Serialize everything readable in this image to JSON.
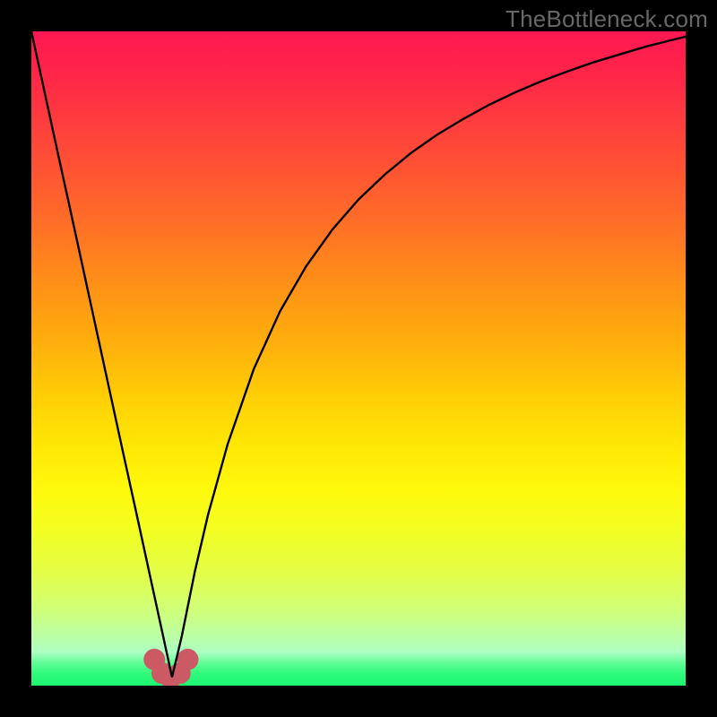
{
  "watermark": "TheBottleneck.com",
  "chart_data": {
    "type": "line",
    "title": "",
    "xlabel": "",
    "ylabel": "",
    "xlim": [
      0,
      1
    ],
    "ylim": [
      0,
      1
    ],
    "series": [
      {
        "name": "curve",
        "color": "#000000",
        "path": "cusp_at_0.21"
      }
    ],
    "x": [
      0.0,
      0.02,
      0.04,
      0.06,
      0.08,
      0.1,
      0.12,
      0.14,
      0.16,
      0.18,
      0.2,
      0.215,
      0.23,
      0.25,
      0.27,
      0.3,
      0.34,
      0.38,
      0.42,
      0.46,
      0.5,
      0.54,
      0.58,
      0.62,
      0.66,
      0.7,
      0.74,
      0.78,
      0.82,
      0.86,
      0.9,
      0.94,
      0.98,
      1.0
    ],
    "values": [
      1.0,
      0.908,
      0.816,
      0.725,
      0.633,
      0.541,
      0.449,
      0.357,
      0.266,
      0.174,
      0.082,
      0.013,
      0.076,
      0.175,
      0.261,
      0.369,
      0.484,
      0.572,
      0.641,
      0.697,
      0.743,
      0.781,
      0.814,
      0.842,
      0.866,
      0.888,
      0.907,
      0.924,
      0.939,
      0.953,
      0.965,
      0.977,
      0.987,
      0.992
    ],
    "gradient_stops": [
      {
        "offset": 0.0,
        "color": "#ff1752"
      },
      {
        "offset": 0.07,
        "color": "#ff2748"
      },
      {
        "offset": 0.19,
        "color": "#ff4d36"
      },
      {
        "offset": 0.28,
        "color": "#ff6a29"
      },
      {
        "offset": 0.4,
        "color": "#ff9515"
      },
      {
        "offset": 0.48,
        "color": "#ffb00c"
      },
      {
        "offset": 0.56,
        "color": "#ffcf06"
      },
      {
        "offset": 0.63,
        "color": "#ffe605"
      },
      {
        "offset": 0.7,
        "color": "#fff90c"
      },
      {
        "offset": 0.76,
        "color": "#f3fe21"
      },
      {
        "offset": 0.825,
        "color": "#e4fe46"
      },
      {
        "offset": 0.884,
        "color": "#d0ff78"
      },
      {
        "offset": 0.932,
        "color": "#b7ffae"
      },
      {
        "offset": 0.949,
        "color": "#adffc3"
      },
      {
        "offset": 0.965,
        "color": "#62fd97"
      },
      {
        "offset": 0.982,
        "color": "#2ef97b"
      },
      {
        "offset": 1.0,
        "color": "#1df773"
      }
    ],
    "dots": {
      "color": "#cc5a64",
      "r": 12,
      "points": [
        {
          "x": 0.188,
          "y": 0.04
        },
        {
          "x": 0.2,
          "y": 0.019
        },
        {
          "x": 0.213,
          "y": 0.012
        },
        {
          "x": 0.227,
          "y": 0.019
        },
        {
          "x": 0.239,
          "y": 0.04
        }
      ]
    }
  }
}
